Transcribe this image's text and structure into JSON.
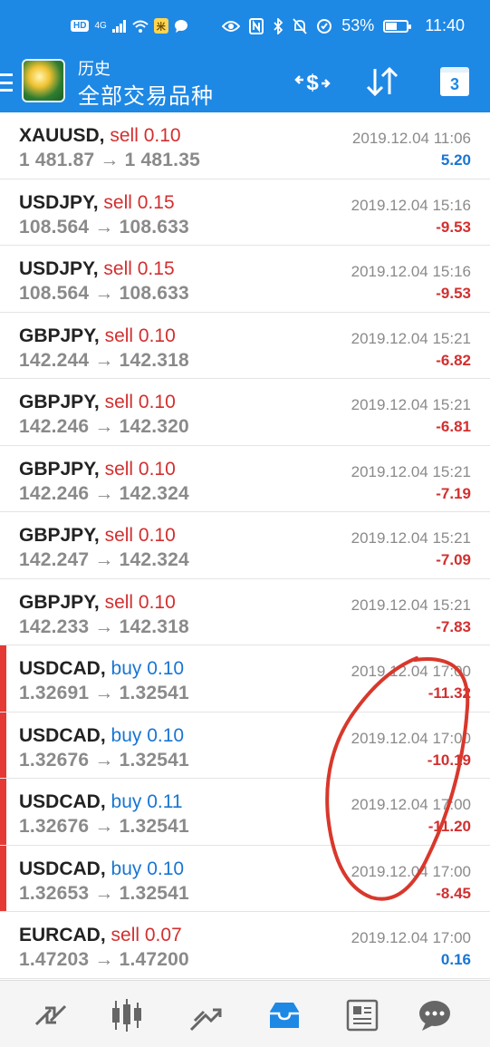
{
  "status_bar": {
    "hd_chip": "HD",
    "network": "4G",
    "battery_text": "53%",
    "battery_level": 0.53,
    "time": "11:40"
  },
  "app_bar": {
    "subtitle": "历史",
    "title": "全部交易品种",
    "calendar_day": "3",
    "icons": [
      "menu-icon",
      "app-logo",
      "currency-exchange-icon",
      "sort-icon",
      "calendar-icon"
    ]
  },
  "trades": [
    {
      "symbol": "XAUUSD,",
      "direction": "sell",
      "volume": "0.10",
      "prices": "1 481.87 → 1 481.35",
      "datetime": "2019.12.04 11:06",
      "profit": "5.20",
      "profit_sign": "pos",
      "marked": false
    },
    {
      "symbol": "USDJPY,",
      "direction": "sell",
      "volume": "0.15",
      "prices": "108.564 → 108.633",
      "datetime": "2019.12.04 15:16",
      "profit": "-9.53",
      "profit_sign": "neg",
      "marked": false
    },
    {
      "symbol": "USDJPY,",
      "direction": "sell",
      "volume": "0.15",
      "prices": "108.564 → 108.633",
      "datetime": "2019.12.04 15:16",
      "profit": "-9.53",
      "profit_sign": "neg",
      "marked": false
    },
    {
      "symbol": "GBPJPY,",
      "direction": "sell",
      "volume": "0.10",
      "prices": "142.244 → 142.318",
      "datetime": "2019.12.04 15:21",
      "profit": "-6.82",
      "profit_sign": "neg",
      "marked": false
    },
    {
      "symbol": "GBPJPY,",
      "direction": "sell",
      "volume": "0.10",
      "prices": "142.246 → 142.320",
      "datetime": "2019.12.04 15:21",
      "profit": "-6.81",
      "profit_sign": "neg",
      "marked": false
    },
    {
      "symbol": "GBPJPY,",
      "direction": "sell",
      "volume": "0.10",
      "prices": "142.246 → 142.324",
      "datetime": "2019.12.04 15:21",
      "profit": "-7.19",
      "profit_sign": "neg",
      "marked": false
    },
    {
      "symbol": "GBPJPY,",
      "direction": "sell",
      "volume": "0.10",
      "prices": "142.247 → 142.324",
      "datetime": "2019.12.04 15:21",
      "profit": "-7.09",
      "profit_sign": "neg",
      "marked": false
    },
    {
      "symbol": "GBPJPY,",
      "direction": "sell",
      "volume": "0.10",
      "prices": "142.233 → 142.318",
      "datetime": "2019.12.04 15:21",
      "profit": "-7.83",
      "profit_sign": "neg",
      "marked": false
    },
    {
      "symbol": "USDCAD,",
      "direction": "buy",
      "volume": "0.10",
      "prices": "1.32691 → 1.32541",
      "datetime": "2019.12.04 17:00",
      "profit": "-11.32",
      "profit_sign": "neg",
      "marked": true
    },
    {
      "symbol": "USDCAD,",
      "direction": "buy",
      "volume": "0.10",
      "prices": "1.32676 → 1.32541",
      "datetime": "2019.12.04 17:00",
      "profit": "-10.19",
      "profit_sign": "neg",
      "marked": true
    },
    {
      "symbol": "USDCAD,",
      "direction": "buy",
      "volume": "0.11",
      "prices": "1.32676 → 1.32541",
      "datetime": "2019.12.04 17:00",
      "profit": "-11.20",
      "profit_sign": "neg",
      "marked": true
    },
    {
      "symbol": "USDCAD,",
      "direction": "buy",
      "volume": "0.10",
      "prices": "1.32653 → 1.32541",
      "datetime": "2019.12.04 17:00",
      "profit": "-8.45",
      "profit_sign": "neg",
      "marked": true
    },
    {
      "symbol": "EURCAD,",
      "direction": "sell",
      "volume": "0.07",
      "prices": "1.47203 → 1.47200",
      "datetime": "2019.12.04 17:00",
      "profit": "0.16",
      "profit_sign": "pos",
      "marked": false
    }
  ],
  "bottom_nav": [
    "quotes-icon",
    "chart-icon",
    "trade-icon",
    "history-icon",
    "news-icon",
    "chat-icon"
  ],
  "colors": {
    "primary": "#1e88e5",
    "sell": "#d32f2f",
    "buy": "#1976d2",
    "marker": "#e53935",
    "annotation": "#d8382c"
  }
}
